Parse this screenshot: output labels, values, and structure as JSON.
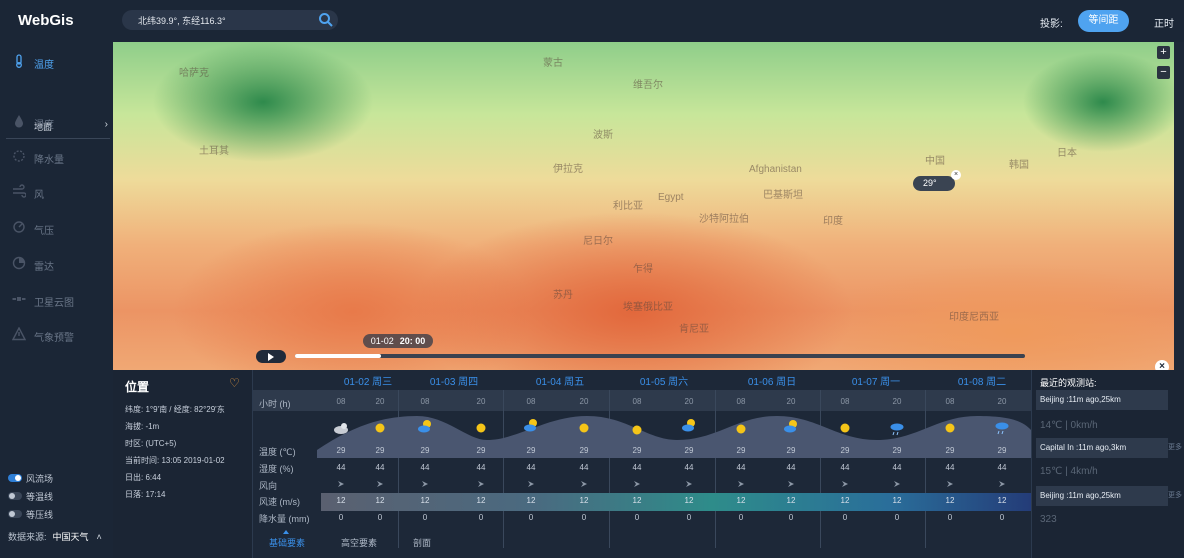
{
  "app": {
    "title": "WebGis",
    "search_value": "北纬39.9°, 东经116.3°",
    "projection_label": "投影:",
    "projection_value": "等间距",
    "projection_option_right": "正时"
  },
  "sidebar": {
    "items": [
      {
        "label": "温度",
        "icon": "thermometer-icon",
        "active": true
      },
      {
        "label": "湿度",
        "icon": "humidity-icon",
        "active": false
      },
      {
        "label": "降水量",
        "icon": "precipitation-icon",
        "active": false
      },
      {
        "label": "风",
        "icon": "wind-icon",
        "active": false
      },
      {
        "label": "气压",
        "icon": "pressure-icon",
        "active": false
      },
      {
        "label": "雷达",
        "icon": "radar-icon",
        "active": false
      },
      {
        "label": "卫星云图",
        "icon": "satellite-icon",
        "active": false
      },
      {
        "label": "气象预警",
        "icon": "warning-icon",
        "active": false
      }
    ],
    "sub_item": "地面",
    "toggles": [
      {
        "label": "风流场",
        "on": true
      },
      {
        "label": "等温线",
        "on": false
      },
      {
        "label": "等压线",
        "on": false
      }
    ],
    "source_label": "数据来源:",
    "source_value": "中国天气"
  },
  "map": {
    "labels": [
      "哈萨克",
      "蒙古",
      "维吾尔",
      "土耳其",
      "波斯",
      "伊拉克",
      "利比亚",
      "Egypt",
      "沙特阿拉伯",
      "印度",
      "Afghanistan",
      "巴基斯坦",
      "尼日尔",
      "乍得",
      "苏丹",
      "埃塞俄比亚",
      "肯尼亚",
      "中国",
      "韩国",
      "日本",
      "印度尼西亚"
    ],
    "popup_temp": "29°",
    "time_date": "01-02",
    "time_hour": "20: 00"
  },
  "location": {
    "title": "位置",
    "lat_lon": "纬度: 1°9'南  /  经度: 82°29'东",
    "altitude": "海拔: -1m",
    "timezone": "时区: (UTC+5)",
    "current_time": "当前时间: 13:05  2019-01-02",
    "sunrise": "日出: 6:44",
    "sunset": "日落: 17:14"
  },
  "forecast": {
    "days": [
      "01-02 周三",
      "01-03 周四",
      "01-04 周五",
      "01-05 周六",
      "01-06 周日",
      "01-07 周一",
      "01-08 周二"
    ],
    "hours_label": "小时 (h)",
    "hours": [
      "08",
      "20",
      "08",
      "20",
      "08",
      "20",
      "08",
      "20",
      "08",
      "20",
      "08",
      "20",
      "08",
      "20"
    ],
    "temp_label": "温度 (℃)",
    "temps": [
      "29",
      "29",
      "29",
      "29",
      "29",
      "29",
      "29",
      "29",
      "29",
      "29",
      "29",
      "29",
      "29",
      "29"
    ],
    "humidity_label": "湿度 (%)",
    "humidity": [
      "44",
      "44",
      "44",
      "44",
      "44",
      "44",
      "44",
      "44",
      "44",
      "44",
      "44",
      "44",
      "44",
      "44"
    ],
    "wind_dir_label": "风向",
    "wind_speed_label": "风速 (m/s)",
    "wind_speed": [
      "12",
      "12",
      "12",
      "12",
      "12",
      "12",
      "12",
      "12",
      "12",
      "12",
      "12",
      "12",
      "12",
      "12"
    ],
    "precip_label": "降水量 (mm)",
    "precip": [
      "0",
      "0",
      "0",
      "0",
      "0",
      "0",
      "0",
      "0",
      "0",
      "0",
      "0",
      "0",
      "0",
      "0"
    ],
    "weather_icons": [
      "cloudy-night-icon",
      "sun-icon",
      "partly-cloudy-icon",
      "sun-icon",
      "partly-cloudy-icon",
      "sun-icon",
      "sun-icon",
      "partly-cloudy-icon",
      "sun-icon",
      "partly-cloudy-icon",
      "sun-icon",
      "rain-cloud-icon",
      "sun-icon",
      "rain-cloud-icon"
    ]
  },
  "tabs": [
    "基础要素",
    "高空要素",
    "剖面"
  ],
  "observations": {
    "title": "最近的观测站:",
    "stations": [
      {
        "name": "Beijing :11m ago,25km",
        "value": "14℃  |  0km/h"
      },
      {
        "name": "Capital In :11m ago,3km",
        "value": "15℃  |  4km/h",
        "more": "更多"
      },
      {
        "name": "Beijing :11m ago,25km",
        "value": "323",
        "more": "更多"
      }
    ]
  }
}
